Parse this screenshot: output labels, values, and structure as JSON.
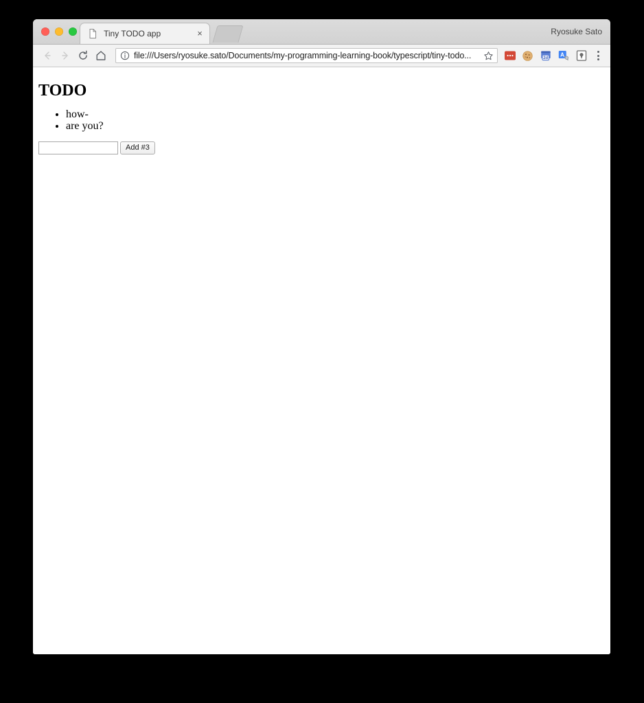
{
  "window": {
    "traffic_lights": [
      {
        "name": "close",
        "color": "#ff5f57"
      },
      {
        "name": "minimize",
        "color": "#febc2e"
      },
      {
        "name": "maximize",
        "color": "#28c840"
      }
    ],
    "profile_name": "Ryosuke Sato"
  },
  "tabs": [
    {
      "title": "Tiny TODO app",
      "favicon": "document-icon",
      "close_label": "×",
      "active": true
    }
  ],
  "toolbar": {
    "back_label": "Back",
    "forward_label": "Forward",
    "reload_label": "Reload",
    "home_label": "Home",
    "omnibox": {
      "url": "file:///Users/ryosuke.sato/Documents/my-programming-learning-book/typescript/tiny-todo...",
      "security_icon": "info-icon",
      "bookmark_icon": "star-icon"
    },
    "extensions": [
      {
        "name": "lastpass-icon",
        "color": "#d34836"
      },
      {
        "name": "cookie-icon",
        "color": "#d8a657"
      },
      {
        "name": "window-resizer-icon",
        "color": "#5b7fd4",
        "badge": "2d"
      },
      {
        "name": "translate-icon",
        "color": "#4285f4"
      },
      {
        "name": "shield-icon",
        "color": "#6b6b6b"
      }
    ],
    "menu_label": "Customize and control Google Chrome"
  },
  "page": {
    "heading": "TODO",
    "todos": [
      "how-",
      "are you?"
    ],
    "input_value": "",
    "input_placeholder": "",
    "add_button_label": "Add #3"
  }
}
